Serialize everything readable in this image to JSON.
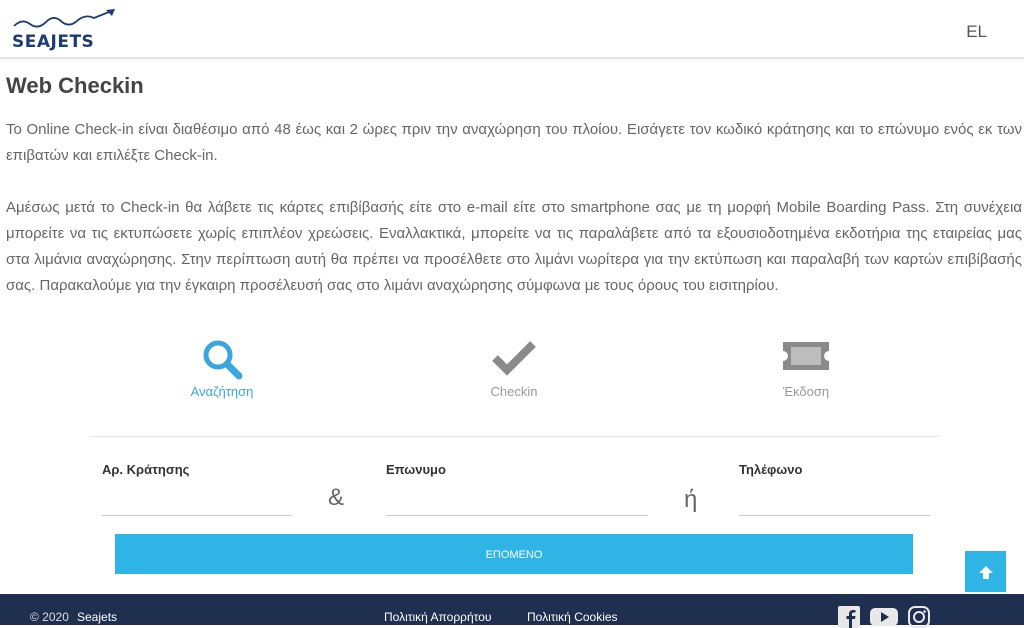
{
  "header": {
    "logo_text": "SEAJETS",
    "lang": "EL"
  },
  "page_title": "Web Checkin",
  "paragraphs": {
    "p1": "Το Online Check-in είναι διαθέσιμο από 48 έως και 2 ώρες πριν την αναχώρηση του πλοίου. Εισάγετε τον κωδικό κράτησης και το επώνυμο ενός εκ των επιβατών και επιλέξτε Check-in.",
    "p2": "Αμέσως μετά το Check-in θα λάβετε τις κάρτες επιβίβασής είτε στο e-mail είτε στο smartphone σας με τη μορφή Mobile Boarding Pass. Στη συνέχεια μπορείτε να τις εκτυπώσετε χωρίς επιπλέον χρεώσεις. Εναλλακτικά, μπορείτε να τις παραλάβετε από τα εξουσιοδοτημένα εκδοτήρια της εταιρείας μας στα λιμάνια αναχώρησης. Στην περίπτωση αυτή θα πρέπει να προσέλθετε στο λιμάνι νωρίτερα για την εκτύπωση και παραλαβή των καρτών επιβίβασής σας. Παρακαλούμε για την έγκαιρη προσέλευσή σας στο λιμάνι αναχώρησης σύμφωνα με τους όρους του εισιτηρίου."
  },
  "steps": [
    {
      "label": "Αναζήτηση",
      "icon": "search-icon",
      "active": true
    },
    {
      "label": "Checkin",
      "icon": "check-icon",
      "active": false
    },
    {
      "label": "Έκδοση",
      "icon": "ticket-icon",
      "active": false
    }
  ],
  "form": {
    "booking_label": "Αρ. Κράτησης",
    "booking_value": "",
    "surname_label": "Επωνυμο",
    "surname_value": "",
    "phone_label": "Τηλέφωνο",
    "phone_value": "",
    "and_sep": "&",
    "or_sep": "ή",
    "next_label": "ΕΠΟΜΕΝΟ"
  },
  "footer": {
    "copyright": "© 2020",
    "company": "Seajets",
    "privacy": "Πολιτική Απορρήτου",
    "cookies": "Πολιτική Cookies"
  },
  "colors": {
    "accent": "#2fb4e6",
    "navy": "#1e2f4f",
    "brand": "#1b3d72"
  }
}
